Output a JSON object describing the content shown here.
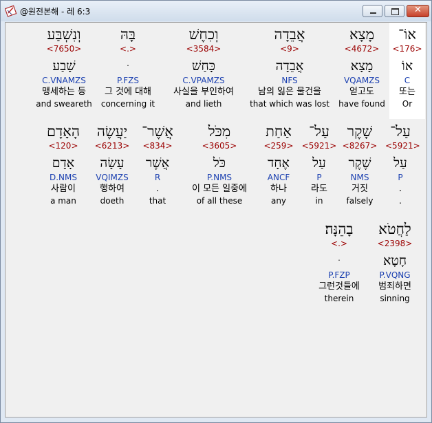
{
  "window": {
    "title": "@원전본해 - 레 6:3",
    "close_label": "✕"
  },
  "colors": {
    "strong": "#9b0000",
    "morph": "#1a3fb0",
    "highlight": "#ffffff"
  },
  "rows": [
    [
      {
        "heb": "אוֹ־",
        "strong": "<176>",
        "lemma": "אוֹ",
        "morph": "C",
        "kor": "또는",
        "eng": "Or"
      },
      {
        "heb": "מָצָא",
        "strong": "<4672>",
        "lemma": "מָצָא",
        "morph": "VQAMZS",
        "kor": "얻고도",
        "eng": "have found"
      },
      {
        "heb": "אֲבֵדָה",
        "strong": "<9>",
        "lemma": "אֲבֵדָה",
        "morph": "NFS",
        "kor": "남의 잃은 물건을",
        "eng": "that which was lost"
      },
      {
        "heb": "וְכִחֶשׁ",
        "strong": "<3584>",
        "lemma": "כָּחַשׁ",
        "morph": "C.VPAMZS",
        "kor": "사실을 부인하여",
        "eng": "and lieth"
      },
      {
        "heb": "בָּהּ",
        "strong": "<.>",
        "lemma": "ּ",
        "morph": "P.FZS",
        "kor": "그 것에 대해",
        "eng": "concerning it"
      },
      {
        "heb": "וְנִשְׁבַּע",
        "strong": "<7650>",
        "lemma": "שָׁבַע",
        "morph": "C.VNAMZS",
        "kor": "맹세하는 등",
        "eng": "and sweareth"
      }
    ],
    [
      {
        "heb": "עַל־",
        "strong": "<5921>",
        "lemma": "עַל",
        "morph": "P",
        "kor": ".",
        "eng": "."
      },
      {
        "heb": "שָׁקֶר",
        "strong": "<8267>",
        "lemma": "שֶׁקֶר",
        "morph": "NMS",
        "kor": "거짓",
        "eng": "falsely"
      },
      {
        "heb": "עַל־",
        "strong": "<5921>",
        "lemma": "עַל",
        "morph": "P",
        "kor": "라도",
        "eng": "in"
      },
      {
        "heb": "אַחַת",
        "strong": "<259>",
        "lemma": "אֶחָד",
        "morph": "ANCF",
        "kor": "하나",
        "eng": "any"
      },
      {
        "heb": "מִכֹּל",
        "strong": "<3605>",
        "lemma": "כֹּל",
        "morph": "P.NMS",
        "kor": "이 모든 일중에",
        "eng": "of all these"
      },
      {
        "heb": "אֲשֶׁר־",
        "strong": "<834>",
        "lemma": "אֲשֶׁר",
        "morph": "R",
        "kor": ".",
        "eng": "that"
      },
      {
        "heb": "יַעֲשֶׂה",
        "strong": "<6213>",
        "lemma": "עָשָׂה",
        "morph": "VQIMZS",
        "kor": "행하여",
        "eng": "doeth"
      },
      {
        "heb": "הָאָדָם",
        "strong": "<120>",
        "lemma": "אָדָם",
        "morph": "D.NMS",
        "kor": "사람이",
        "eng": "a man"
      }
    ],
    [
      {
        "heb": "לַחֲטֹא",
        "strong": "<2398>",
        "lemma": "חָטָא",
        "morph": "P.VQNG",
        "kor": "범죄하면",
        "eng": "sinning"
      },
      {
        "heb": "בָהֵנָּה׃",
        "strong": "<.>",
        "lemma": "ּ",
        "morph": "P.FZP",
        "kor": "그런것들에",
        "eng": "therein"
      }
    ]
  ]
}
